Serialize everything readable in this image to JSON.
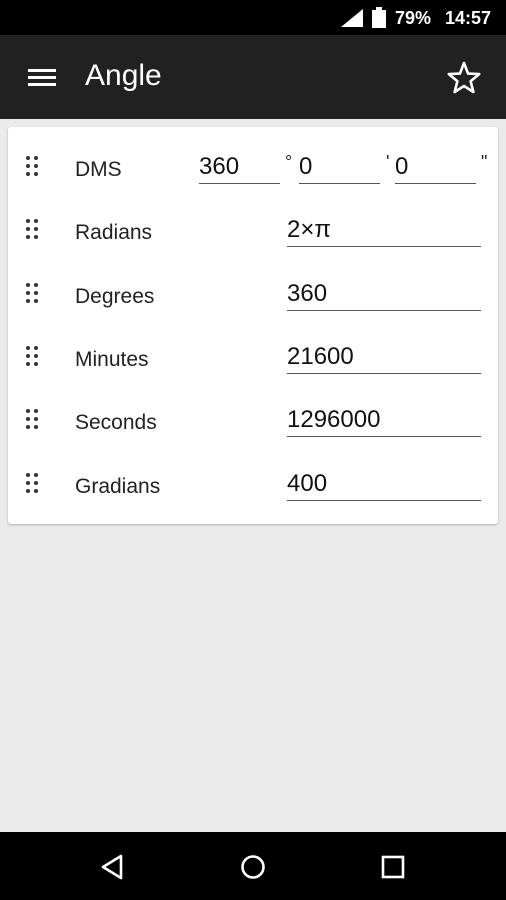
{
  "status": {
    "battery_pct": "79%",
    "time": "14:57"
  },
  "app_bar": {
    "title": "Angle",
    "menu_icon": "hamburger-menu-icon",
    "favorite_icon": "star-outline-icon"
  },
  "units": {
    "dms": {
      "label": "DMS",
      "degrees": "360",
      "degree_symbol": "°",
      "minutes": "0",
      "minute_symbol": "'",
      "seconds": "0",
      "second_symbol": "\""
    },
    "radians": {
      "label": "Radians",
      "value": "2×π"
    },
    "degrees": {
      "label": "Degrees",
      "value": "360"
    },
    "minutes": {
      "label": "Minutes",
      "value": "21600"
    },
    "seconds": {
      "label": "Seconds",
      "value": "1296000"
    },
    "gradians": {
      "label": "Gradians",
      "value": "400"
    }
  },
  "nav": {
    "back_icon": "back-triangle-icon",
    "home_icon": "home-circle-icon",
    "recents_icon": "recents-square-icon"
  },
  "colors": {
    "app_bar": "#212121",
    "background": "#ebebeb",
    "card": "#ffffff"
  }
}
